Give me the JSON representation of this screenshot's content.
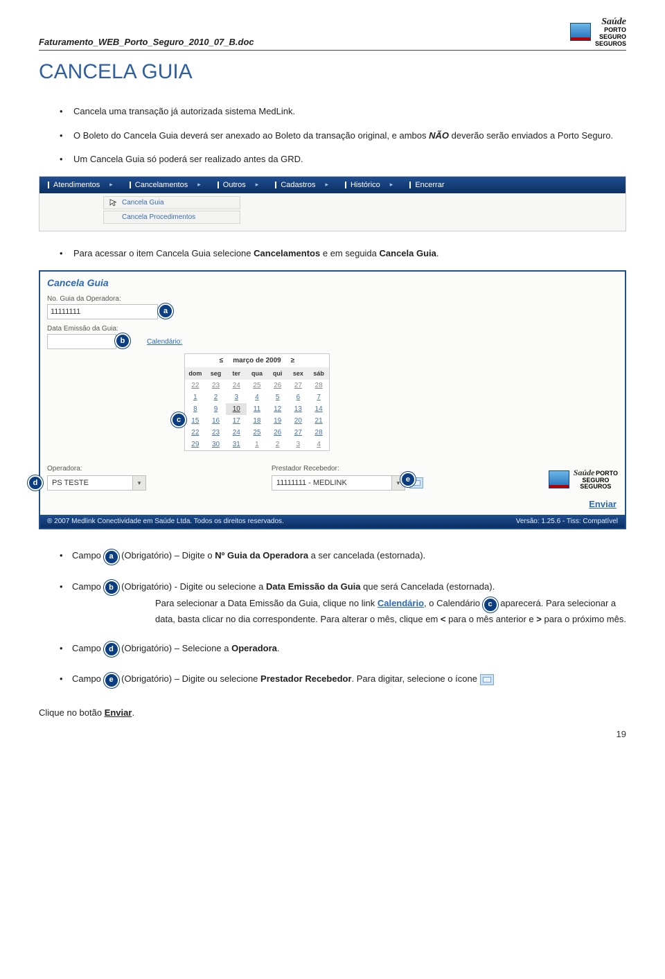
{
  "doc": {
    "filename": "Faturamento_WEB_Porto_Seguro_2010_07_B.doc",
    "brand": {
      "saude": "Saúde",
      "l1": "PORTO",
      "l2": "SEGURO",
      "l3": "SEGUROS"
    }
  },
  "title": "CANCELA GUIA",
  "bullets": {
    "b1": "Cancela uma transação já autorizada sistema MedLink.",
    "b2_a": "O Boleto do Cancela Guia deverá ser anexado ao Boleto da transação original, e ambos ",
    "b2_b": "NÃO",
    "b2_c": " deverão serão enviados a Porto Seguro.",
    "b3": "Um Cancela Guia só poderá ser realizado antes da GRD."
  },
  "nav": {
    "items": [
      "Atendimentos",
      "Cancelamentos",
      "Outros",
      "Cadastros",
      "Histórico",
      "Encerrar"
    ],
    "sub": [
      "Cancela Guia",
      "Cancela Procedimentos"
    ]
  },
  "access_a": "Para acessar o item Cancela Guia selecione ",
  "access_b": "Cancelamentos",
  "access_c": " e em seguida ",
  "access_d": "Cancela Guia",
  "access_e": ".",
  "app": {
    "title": "Cancela Guia",
    "lbl_guia": "No. Guia da Operadora:",
    "val_guia": "11111111",
    "lbl_data": "Data Emissão da Guia:",
    "cal_link": "Calendário:",
    "cal": {
      "prev": "≤",
      "next": "≥",
      "month": "março de 2009",
      "dow": [
        "dom",
        "seg",
        "ter",
        "qua",
        "qui",
        "sex",
        "sáb"
      ],
      "weeks": [
        [
          "22",
          "23",
          "24",
          "25",
          "26",
          "27",
          "28"
        ],
        [
          "1",
          "2",
          "3",
          "4",
          "5",
          "6",
          "7"
        ],
        [
          "8",
          "9",
          "10",
          "11",
          "12",
          "13",
          "14"
        ],
        [
          "15",
          "16",
          "17",
          "18",
          "19",
          "20",
          "21"
        ],
        [
          "22",
          "23",
          "24",
          "25",
          "26",
          "27",
          "28"
        ],
        [
          "29",
          "30",
          "31",
          "1",
          "2",
          "3",
          "4"
        ]
      ],
      "selected": "10"
    },
    "lbl_op": "Operadora:",
    "val_op": "PS TESTE",
    "lbl_rec": "Prestador Recebedor:",
    "val_rec": "11111111 - MEDLINK",
    "enviar": "Enviar",
    "foot_l": "® 2007 Medlink Conectividade em Saúde Ltda.   Todos os direitos reservados.",
    "foot_r": "Versão: 1.25.6 - Tiss: Compatível"
  },
  "badges": {
    "a": "a",
    "b": "b",
    "c": "c",
    "d": "d",
    "e": "e"
  },
  "fields": {
    "a_pre": "Campo ",
    "a_mid": "  (Obrigatório) – Digite o ",
    "a_b1": "Nº Guia da Operadora",
    "a_suf": " a ser cancelada (estornada).",
    "b_pre": "Campo ",
    "b_mid": " (Obrigatório) - Digite ou selecione a ",
    "b_b1": "Data Emissão da Guia",
    "b_suf": " que será Cancelada (estornada).",
    "b_l2a": "Para selecionar a Data Emissão da Guia, clique no link ",
    "b_l2b": "Calendário",
    "b_l2c": ", o Calendário ",
    "b_l3": "aparecerá. Para selecionar a data, basta clicar no dia correspondente. Para alterar o mês, clique em ",
    "b_l3_lt": "<",
    "b_l3_mid": " para o mês anterior e ",
    "b_l3_gt": ">",
    "b_l3_end": " para o próximo mês.",
    "d_pre": "Campo ",
    "d_mid": "  (Obrigatório) – Selecione a ",
    "d_b1": "Operadora",
    "d_suf": ".",
    "e_pre": "Campo ",
    "e_mid": "  (Obrigatório) – Digite ou selecione ",
    "e_b1": "Prestador Recebedor",
    "e_suf": ". Para digitar, selecione o ícone "
  },
  "final_a": "Clique no botão ",
  "final_b": "Enviar",
  "final_c": ".",
  "pagenum": "19"
}
